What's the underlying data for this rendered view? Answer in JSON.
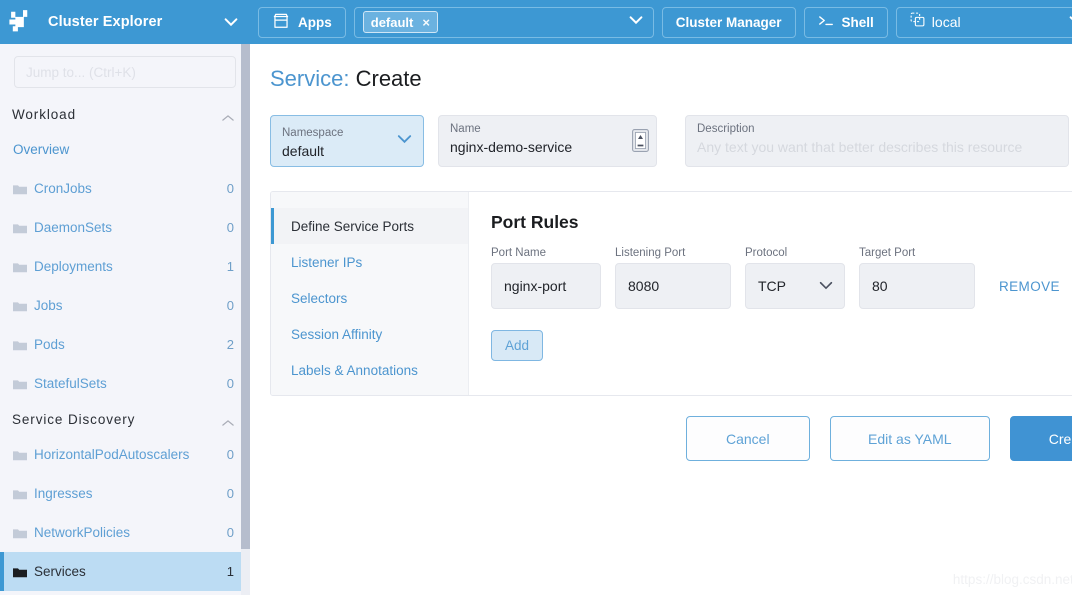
{
  "sidebar": {
    "brand": "Cluster Explorer",
    "search_placeholder": "Jump to... (Ctrl+K)",
    "groups": [
      {
        "title": "Workload",
        "items": [
          {
            "label": "Overview",
            "count": "",
            "type": "link"
          },
          {
            "label": "CronJobs",
            "count": "0",
            "type": "folder"
          },
          {
            "label": "DaemonSets",
            "count": "0",
            "type": "folder"
          },
          {
            "label": "Deployments",
            "count": "1",
            "type": "folder"
          },
          {
            "label": "Jobs",
            "count": "0",
            "type": "folder"
          },
          {
            "label": "Pods",
            "count": "2",
            "type": "folder"
          },
          {
            "label": "StatefulSets",
            "count": "0",
            "type": "folder"
          }
        ]
      },
      {
        "title": "Service Discovery",
        "items": [
          {
            "label": "HorizontalPodAutoscalers",
            "count": "0",
            "type": "folder"
          },
          {
            "label": "Ingresses",
            "count": "0",
            "type": "folder"
          },
          {
            "label": "NetworkPolicies",
            "count": "0",
            "type": "folder"
          },
          {
            "label": "Services",
            "count": "1",
            "type": "folder",
            "active": true
          }
        ]
      }
    ]
  },
  "topbar": {
    "apps_label": "Apps",
    "namespace_chip": "default",
    "namespace_chip_remove": "×",
    "cluster_manager_label": "Cluster Manager",
    "shell_label": "Shell",
    "cluster_name": "local"
  },
  "page": {
    "title_resource": "Service:",
    "title_action": "Create"
  },
  "meta": {
    "namespace_label": "Namespace",
    "namespace_value": "default",
    "name_label": "Name",
    "name_value": "nginx-demo-service",
    "description_label": "Description",
    "description_placeholder": "Any text you want that better describes this resource"
  },
  "tabs": [
    {
      "label": "Define Service Ports",
      "active": true
    },
    {
      "label": "Listener IPs",
      "active": false
    },
    {
      "label": "Selectors",
      "active": false
    },
    {
      "label": "Session Affinity",
      "active": false
    },
    {
      "label": "Labels & Annotations",
      "active": false
    }
  ],
  "port_rules": {
    "heading": "Port Rules",
    "columns": {
      "port_name": "Port Name",
      "listening_port": "Listening Port",
      "protocol": "Protocol",
      "target_port": "Target Port"
    },
    "rows": [
      {
        "port_name": "nginx-port",
        "listening_port": "8080",
        "protocol": "TCP",
        "target_port": "80",
        "remove_label": "REMOVE"
      }
    ],
    "add_label": "Add"
  },
  "actions": {
    "cancel": "Cancel",
    "edit_yaml": "Edit as YAML",
    "create": "Create"
  },
  "watermark": "https://blog.csdn.net/networken",
  "colors": {
    "brand_blue": "#3d98d3",
    "accent_link": "#4c95cf",
    "primary_button": "#4093d3",
    "sidebar_bg": "#f4f5fa",
    "active_nav": "#bcdcf3"
  }
}
